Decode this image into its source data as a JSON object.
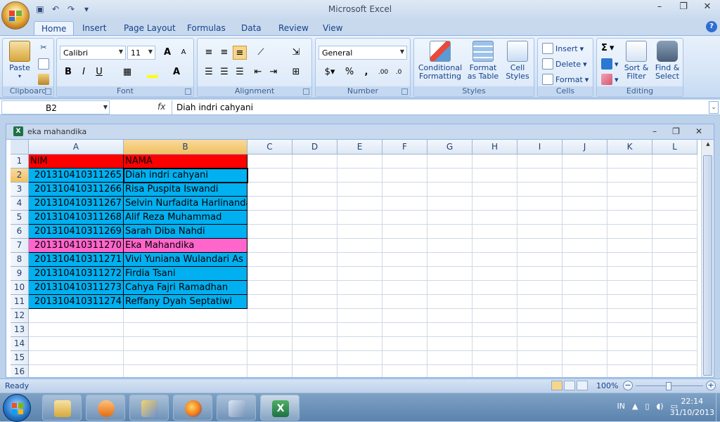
{
  "app": {
    "title": "Microsoft Excel",
    "qat_icons": [
      "save-icon",
      "undo-icon",
      "redo-icon",
      "customize-icon"
    ]
  },
  "tabs": [
    "Home",
    "Insert",
    "Page Layout",
    "Formulas",
    "Data",
    "Review",
    "View"
  ],
  "ribbon": {
    "clipboard": {
      "label": "Clipboard",
      "paste": "Paste"
    },
    "font": {
      "label": "Font",
      "name": "Calibri",
      "size": "11",
      "bold": "B",
      "italic": "I",
      "underline": "U",
      "grow": "A",
      "shrink": "A"
    },
    "alignment": {
      "label": "Alignment"
    },
    "number": {
      "label": "Number",
      "format": "General",
      "percent": "%",
      "comma": ","
    },
    "styles": {
      "label": "Styles",
      "conditional": "Conditional",
      "conditional2": "Formatting",
      "format_table": "Format",
      "format_table2": "as Table",
      "cell_styles": "Cell",
      "cell_styles2": "Styles"
    },
    "cells": {
      "label": "Cells",
      "insert": "Insert",
      "delete": "Delete",
      "format": "Format"
    },
    "editing": {
      "label": "Editing",
      "sigma": "Σ",
      "sort": "Sort &",
      "sort2": "Filter",
      "find": "Find &",
      "find2": "Select"
    }
  },
  "formula_bar": {
    "name_box": "B2",
    "fx": "fx",
    "content": "Diah indri cahyani"
  },
  "workbook": {
    "title": "eka mahandika",
    "columns": [
      "A",
      "B",
      "C",
      "D",
      "E",
      "F",
      "G",
      "H",
      "I",
      "J",
      "K",
      "L"
    ],
    "rows": [
      "1",
      "2",
      "3",
      "4",
      "5",
      "6",
      "7",
      "8",
      "9",
      "10",
      "11",
      "12",
      "13",
      "14",
      "15",
      "16"
    ],
    "header": [
      "NIM",
      "NAMA"
    ],
    "data": [
      [
        "201310410311265",
        "Diah indri cahyani"
      ],
      [
        "201310410311266",
        "Risa Puspita Iswandi"
      ],
      [
        "201310410311267",
        "Selvin Nurfadita Harlinanda"
      ],
      [
        "201310410311268",
        "Alif Reza Muhammad"
      ],
      [
        "201310410311269",
        "Sarah Diba Nahdi"
      ],
      [
        "201310410311270",
        "Eka Mahandika"
      ],
      [
        "201310410311271",
        "Vivi Yuniana Wulandari As"
      ],
      [
        "201310410311272",
        "Firdia Tsani"
      ],
      [
        "201310410311273",
        "Cahya Fajri Ramadhan"
      ],
      [
        "201310410311274",
        "Reffany Dyah Septatiwi"
      ]
    ],
    "colors": {
      "header_fill": "#ff0000",
      "row_fill": "#00b0f0",
      "highlight_fill": "#ff66cc"
    }
  },
  "status": {
    "ready": "Ready",
    "zoom": "100%"
  },
  "taskbar": {
    "language": "IN",
    "time": "22:14",
    "date": "31/10/2013",
    "apps": [
      "file-explorer-icon",
      "media-player-icon",
      "tools-icon",
      "firefox-icon",
      "settings-tools-icon",
      "excel-icon"
    ]
  }
}
